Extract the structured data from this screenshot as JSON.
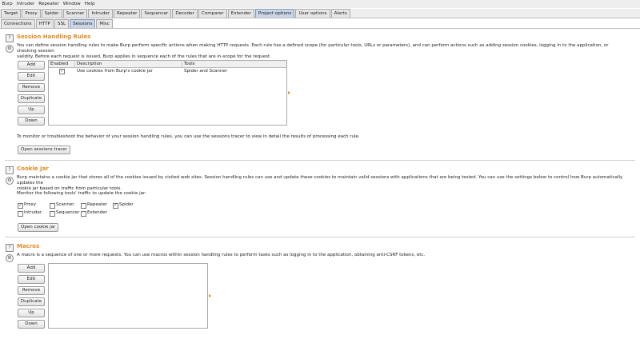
{
  "menu": [
    "Burp",
    "Intruder",
    "Repeater",
    "Window",
    "Help"
  ],
  "main_tabs": [
    "Target",
    "Proxy",
    "Spider",
    "Scanner",
    "Intruder",
    "Repeater",
    "Sequencer",
    "Decoder",
    "Comparer",
    "Extender",
    "Project options",
    "User options",
    "Alerts"
  ],
  "main_tab_active": "Project options",
  "sub_tabs": [
    "Connections",
    "HTTP",
    "SSL",
    "Sessions",
    "Misc"
  ],
  "sub_tab_active": "Sessions",
  "session_handling": {
    "title": "Session Handling Rules",
    "desc1": "You can define session handling rules to make Burp perform specific actions when making HTTP requests. Each rule has a defined scope (for particular tools, URLs or parameters), and can perform actions such as adding session cookies, logging in to the application, or checking session",
    "desc2": "validity. Before each request is issued, Burp applies in sequence each of the rules that are in-scope for the request.",
    "buttons": [
      "Add",
      "Edit",
      "Remove",
      "Duplicate",
      "Up",
      "Down"
    ],
    "columns": [
      "Enabled",
      "Description",
      "Tools"
    ],
    "rows": [
      {
        "enabled": true,
        "description": "Use cookies from Burp's cookie jar",
        "tools": "Spider and Scanner"
      }
    ],
    "tracer_text": "To monitor or troubleshoot the behavior of your session handling rules, you can use the sessions tracer to view in detail the results of processing each rule.",
    "tracer_button": "Open sessions tracer"
  },
  "cookie_jar": {
    "title": "Cookie Jar",
    "desc1": "Burp maintains a cookie jar that stores all of the cookies issued by visited web sites. Session handling rules can use and update these cookies to maintain valid sessions with applications that are being tested. You can use the settings below to control how Burp automatically updates the",
    "desc2": "cookie jar based on traffic from particular tools.",
    "monitor_label": "Monitor the following tools' traffic to update the cookie jar:",
    "tools": [
      {
        "label": "Proxy",
        "checked": true
      },
      {
        "label": "Scanner",
        "checked": false
      },
      {
        "label": "Repeater",
        "checked": false
      },
      {
        "label": "Spider",
        "checked": true
      },
      {
        "label": "Intruder",
        "checked": false
      },
      {
        "label": "Sequencer",
        "checked": false
      },
      {
        "label": "Extender",
        "checked": false
      }
    ],
    "open_button": "Open cookie jar"
  },
  "macros": {
    "title": "Macros",
    "desc": "A macro is a sequence of one or more requests. You can use macros within session handling rules to perform tasks such as logging in to the application, obtaining anti-CSRF tokens, etc.",
    "buttons": [
      "Add",
      "Edit",
      "Remove",
      "Duplicate",
      "Up",
      "Down"
    ]
  },
  "icons": {
    "help": "?",
    "gear": "⚙",
    "check": "✓"
  },
  "colors": {
    "accent": "#e58a1f",
    "active_tab": "#c9d6e8"
  }
}
